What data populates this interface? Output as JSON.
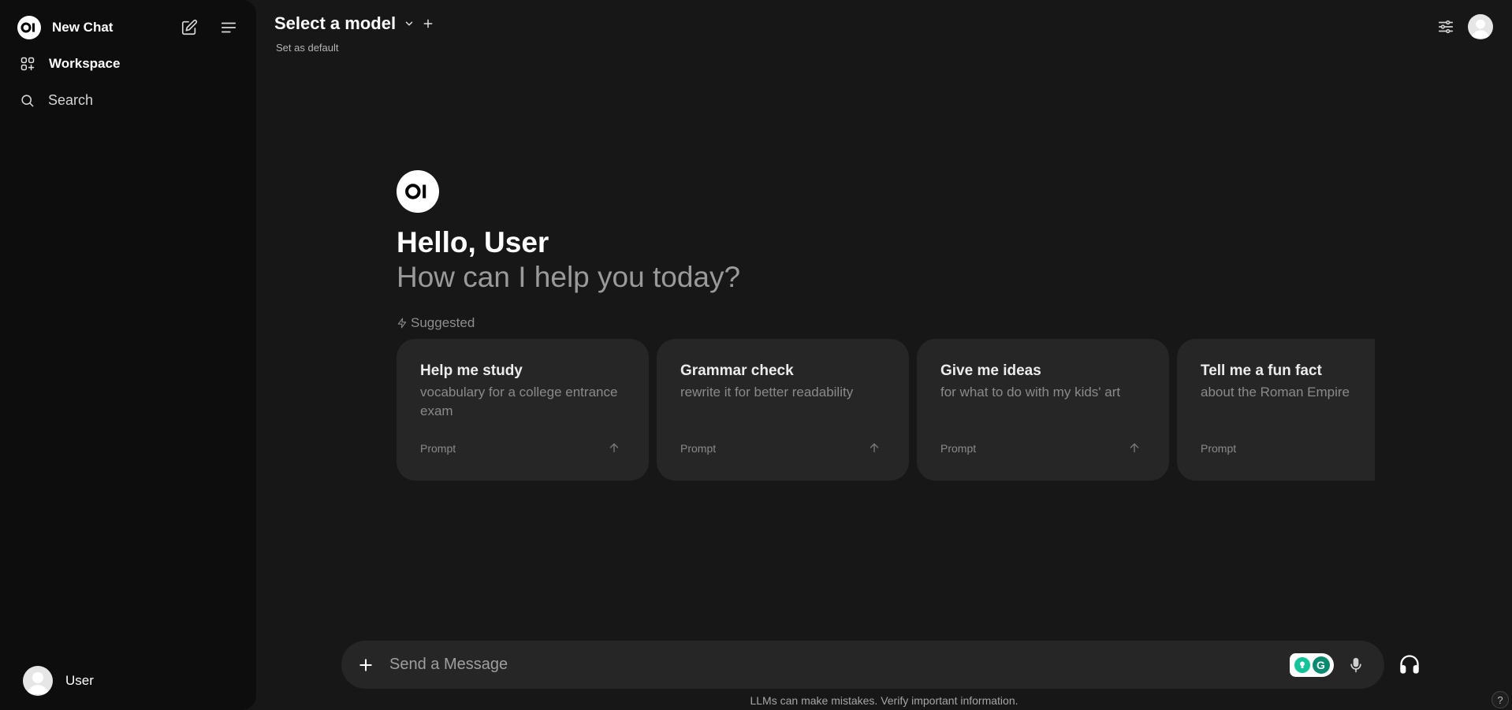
{
  "sidebar": {
    "new_chat_label": "New Chat",
    "workspace_label": "Workspace",
    "search_label": "Search",
    "user_name": "User",
    "logo_text": "OI"
  },
  "header": {
    "model_title": "Select a model",
    "set_default": "Set as default"
  },
  "hero": {
    "logo_text": "OI",
    "greeting": "Hello, User",
    "subtitle": "How can I help you today?",
    "suggested_label": "Suggested"
  },
  "cards": [
    {
      "title": "Help me study",
      "subtitle": "vocabulary for a college entrance exam",
      "prompt_label": "Prompt"
    },
    {
      "title": "Grammar check",
      "subtitle": "rewrite it for better readability",
      "prompt_label": "Prompt"
    },
    {
      "title": "Give me ideas",
      "subtitle": "for what to do with my kids' art",
      "prompt_label": "Prompt"
    },
    {
      "title": "Tell me a fun fact",
      "subtitle": "about the Roman Empire",
      "prompt_label": "Prompt"
    }
  ],
  "composer": {
    "placeholder": "Send a Message",
    "grammarly_letter": "G"
  },
  "footer": {
    "disclaimer": "LLMs can make mistakes. Verify important information.",
    "help": "?"
  },
  "colors": {
    "background": "#171717",
    "sidebar": "#0d0d0d",
    "card": "#262626",
    "grammarly": "#15c39a"
  },
  "icons": [
    "compose-icon",
    "menu-icon",
    "workspace-icon",
    "search-icon",
    "chevron-down-icon",
    "plus-icon",
    "sliders-icon",
    "zap-icon",
    "arrow-up-icon",
    "microphone-icon",
    "headphones-icon"
  ]
}
